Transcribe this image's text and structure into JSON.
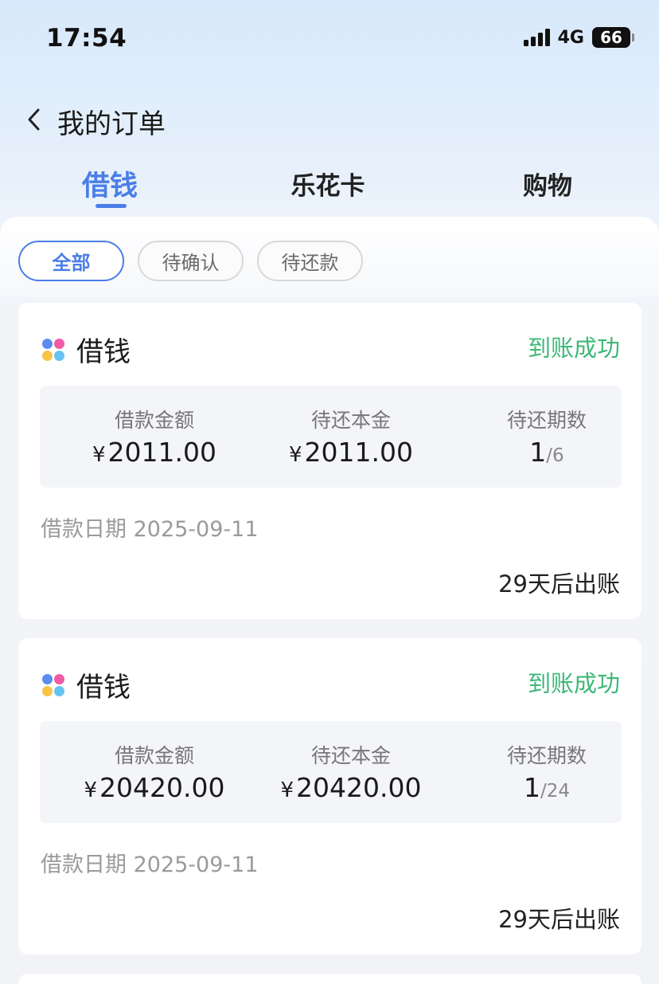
{
  "status_bar": {
    "time": "17:54",
    "network": "4G",
    "battery": "66"
  },
  "header": {
    "back_icon": "chevron-left-icon",
    "title": "我的订单"
  },
  "tabs": [
    {
      "label": "借钱",
      "active": true
    },
    {
      "label": "乐花卡",
      "active": false
    },
    {
      "label": "购物",
      "active": false
    }
  ],
  "filters": [
    {
      "label": "全部",
      "active": true
    },
    {
      "label": "待确认",
      "active": false
    },
    {
      "label": "待还款",
      "active": false
    }
  ],
  "orders": [
    {
      "title": "借钱",
      "status": "到账成功",
      "loan_amount_label": "借款金额",
      "currency": "¥",
      "loan_amount": "2011.00",
      "principal_label": "待还本金",
      "principal": "2011.00",
      "periods_label": "待还期数",
      "period_current": "1",
      "period_total": "/6",
      "date_label": "借款日期",
      "date": "2025-09-11",
      "bill_note": "29天后出账"
    },
    {
      "title": "借钱",
      "status": "到账成功",
      "loan_amount_label": "借款金额",
      "currency": "¥",
      "loan_amount": "20420.00",
      "principal_label": "待还本金",
      "principal": "20420.00",
      "periods_label": "待还期数",
      "period_current": "1",
      "period_total": "/24",
      "date_label": "借款日期",
      "date": "2025-09-11",
      "bill_note": "29天后出账"
    }
  ],
  "colors": {
    "accent": "#4a7ee6",
    "success": "#3db877",
    "brand_icon": [
      "#5b8def",
      "#f25aa8",
      "#f7c545",
      "#65c3f0"
    ]
  }
}
